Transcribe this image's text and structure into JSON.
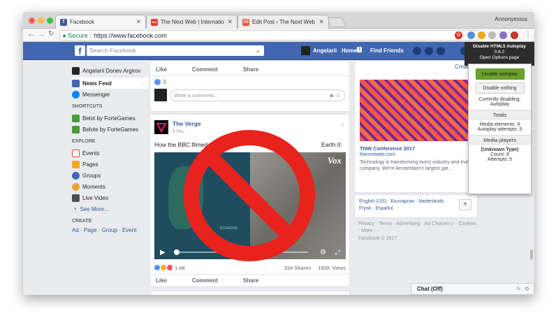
{
  "browser": {
    "tabs": [
      {
        "label": "Facebook",
        "icon": "facebook-favicon",
        "color": "#3b5998",
        "glyph": "f"
      },
      {
        "label": "The Next Web | International t",
        "icon": "tnw-favicon",
        "color": "#e33d3d",
        "glyph": "tnw"
      },
      {
        "label": "Edit Post ‹ The Next Web — W",
        "icon": "edit-post-favicon",
        "color": "#e6533b",
        "glyph": "10"
      }
    ],
    "profile": "Annonymous",
    "url_secure": "Secure",
    "url": "https://www.facebook.com"
  },
  "fb": {
    "search_placeholder": "Search Facebook",
    "user_name": "Angelarii",
    "home": "Home",
    "home_count": "1",
    "find_friends": "Find Friends"
  },
  "leftnav": {
    "profile_name": "Angelarii Donev Argirov",
    "news_feed": "News Feed",
    "more_dots": "···",
    "messenger": "Messenger",
    "shortcuts_heading": "SHORTCUTS",
    "shortcuts": [
      "Belot by ForteGames",
      "Belote by ForteGames"
    ],
    "explore_heading": "EXPLORE",
    "explore": [
      "Events",
      "Pages",
      "Groups",
      "Moments",
      "Live Video"
    ],
    "see_more": "See More...",
    "create_heading": "CREATE",
    "create_links": "Ad · Page · Group · Event"
  },
  "feed": {
    "like": "Like",
    "comment": "Comment",
    "share": "Share",
    "reactions_count": "3",
    "comment_placeholder": "Write a comment...",
    "post_page": "The Verge",
    "post_time": "5 hrs · ",
    "post_text_start": "How the BBC filmed th",
    "post_text_end": "Earth II:",
    "video_brand": "Vox",
    "video_label": "ECUADOR",
    "reactions_total": "1.4K",
    "shares": "334 Shares",
    "views": "185K Views"
  },
  "right": {
    "create": "Create",
    "ad_title": "TNW Conference 2017",
    "ad_domain": "thenextweb.com",
    "ad_text": "Technology is transforming every industry and ever company. We're Amsterdam's largest gat...",
    "languages": "English (US) · Български · Nederlands · Frysk · Español",
    "add_lang": "+",
    "footer": "Privacy · Terms · Advertising · Ad Choices ▷ · Cookies · More ·",
    "copyright": "Facebook © 2017"
  },
  "extension": {
    "tooltip_title": "Disable HTML5 Autoplay",
    "tooltip_version": "0.6.2",
    "tooltip_options": "Open Options page",
    "disable_autoplay": "Disable autoplay",
    "disable_nothing": "Disable nothing",
    "currently": "Currently disabling:",
    "currently_value": "Autoplay",
    "totals": "Totals",
    "media_elements": "Media elements: 9",
    "autoplay_attempts": "Autoplay attempts: 5",
    "media_players": "Media players",
    "unknown_type": "(Unknown Type)",
    "count": "Count: 9",
    "attempts": "Attempts: 5"
  },
  "chat": {
    "label": "Chat (Off)"
  },
  "colors": {
    "fb_blue": "#4267b2",
    "no_sign": "#e8231d",
    "accent_green": "#6aa32a"
  }
}
